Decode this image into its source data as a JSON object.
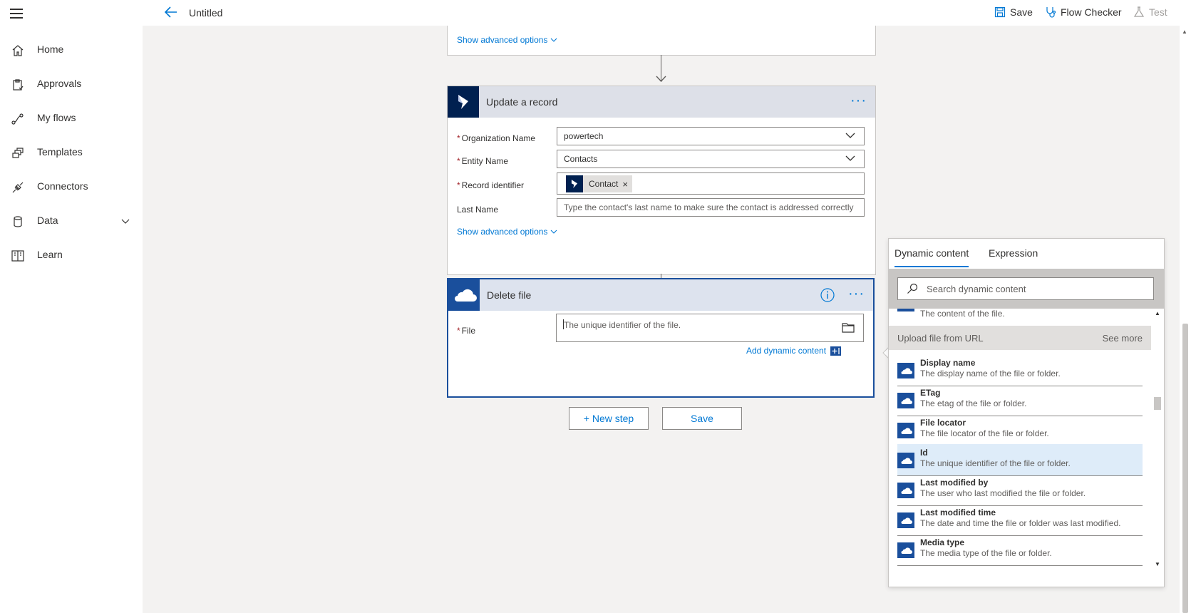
{
  "header": {
    "title": "Untitled",
    "save_label": "Save",
    "checker_label": "Flow Checker",
    "test_label": "Test"
  },
  "nav": {
    "items": [
      {
        "label": "Home",
        "icon": "home-icon"
      },
      {
        "label": "Approvals",
        "icon": "approvals-icon"
      },
      {
        "label": "My flows",
        "icon": "flows-icon"
      },
      {
        "label": "Templates",
        "icon": "templates-icon"
      },
      {
        "label": "Connectors",
        "icon": "connectors-icon"
      },
      {
        "label": "Data",
        "icon": "data-icon"
      },
      {
        "label": "Learn",
        "icon": "learn-icon"
      }
    ]
  },
  "prev_card": {
    "advanced_label": "Show advanced options"
  },
  "update_card": {
    "title": "Update a record",
    "org_label": "Organization Name",
    "org_value": "powertech",
    "entity_label": "Entity Name",
    "entity_value": "Contacts",
    "record_label": "Record identifier",
    "record_token": "Contact",
    "record_token_remove": "×",
    "lastname_label": "Last Name",
    "lastname_placeholder": "Type the contact's last name to make sure the contact is addressed correctly",
    "advanced_label": "Show advanced options"
  },
  "delete_card": {
    "title": "Delete file",
    "file_label": "File",
    "file_placeholder": "The unique identifier of the file.",
    "add_dynamic_label": "Add dynamic content"
  },
  "actions": {
    "new_step_label": "+ New step",
    "save_label": "Save"
  },
  "dynamic_panel": {
    "tabs": [
      "Dynamic content",
      "Expression"
    ],
    "search_placeholder": "Search dynamic content",
    "partial_item_desc": "The content of the file.",
    "section": {
      "name": "Upload file from URL",
      "more": "See more"
    },
    "items": [
      {
        "name": "Display name",
        "desc": "The display name of the file or folder."
      },
      {
        "name": "ETag",
        "desc": "The etag of the file or folder."
      },
      {
        "name": "File locator",
        "desc": "The file locator of the file or folder."
      },
      {
        "name": "Id",
        "desc": "The unique identifier of the file or folder."
      },
      {
        "name": "Last modified by",
        "desc": "The user who last modified the file or folder."
      },
      {
        "name": "Last modified time",
        "desc": "The date and time the file or folder was last modified."
      },
      {
        "name": "Media type",
        "desc": "The media type of the file or folder."
      }
    ],
    "selected_item": "Id"
  },
  "colors": {
    "accent": "#0078d4",
    "card_header": "#dde0e8",
    "dynamics_logo": "#002050",
    "onedrive_logo": "#1a4f9c",
    "required": "#a4262c"
  }
}
